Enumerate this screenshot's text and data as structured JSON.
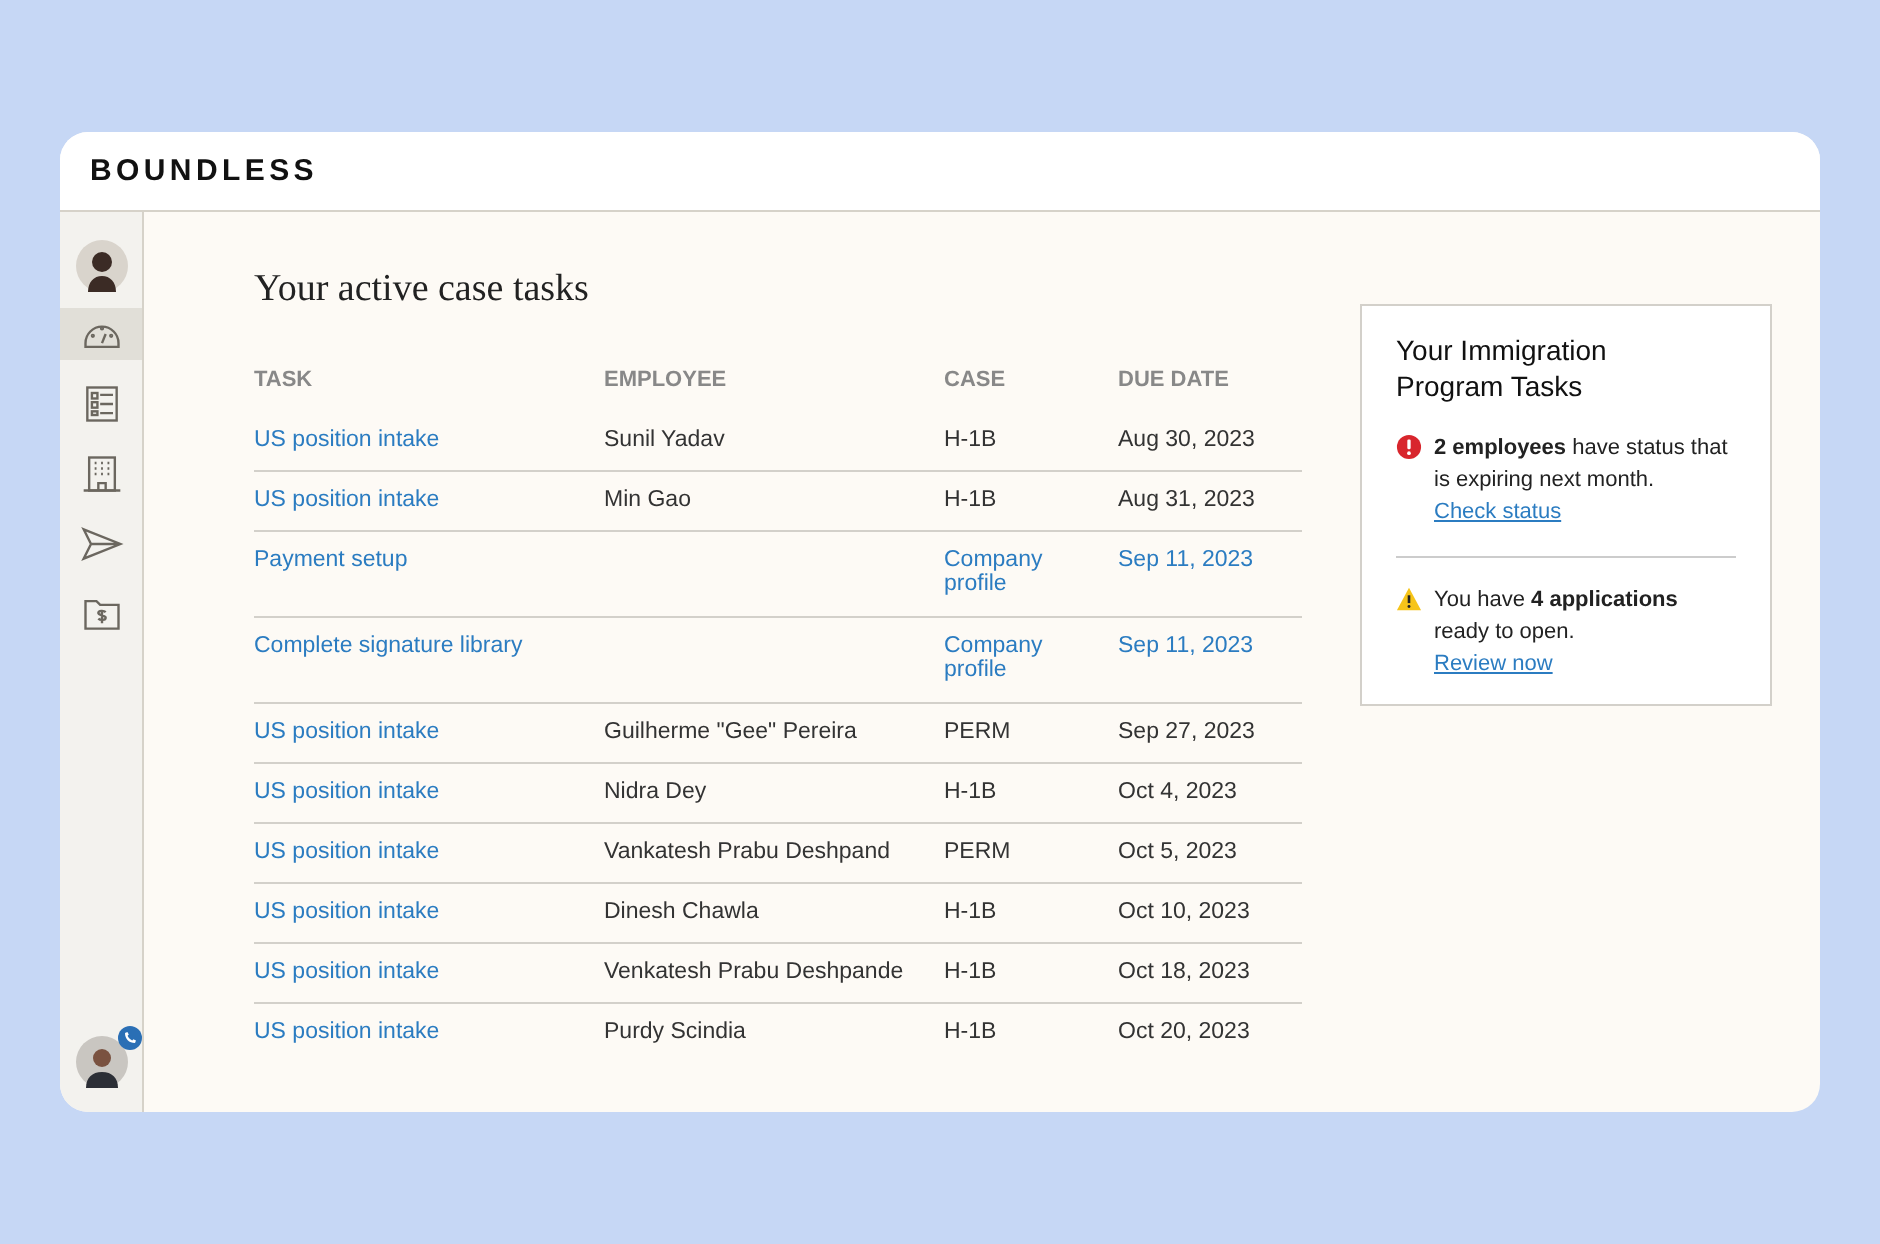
{
  "app": {
    "logo": "BOUNDLESS"
  },
  "sidebar": {
    "items": [
      {
        "kind": "gauge",
        "selected": true
      },
      {
        "kind": "list",
        "selected": false
      },
      {
        "kind": "building",
        "selected": false
      },
      {
        "kind": "send",
        "selected": false
      },
      {
        "kind": "folder",
        "selected": false
      }
    ]
  },
  "main": {
    "title": "Your active case tasks",
    "table": {
      "columns": [
        "TASK",
        "EMPLOYEE",
        "CASE",
        "DUE DATE"
      ],
      "rows": [
        {
          "kind": "employee",
          "task": "US position intake",
          "employee": "Sunil Yadav",
          "case": "H-1B",
          "due": "Aug 30, 2023"
        },
        {
          "kind": "employee",
          "task": "US position intake",
          "employee": "Min Gao",
          "case": "H-1B",
          "due": "Aug 31, 2023"
        },
        {
          "kind": "company",
          "task": "Payment setup",
          "case": "Company profile",
          "due": "Sep 11, 2023"
        },
        {
          "kind": "company",
          "task": "Complete signature library",
          "case": "Company profile",
          "due": "Sep 11, 2023"
        },
        {
          "kind": "employee",
          "task": "US position intake",
          "employee": "Guilherme \"Gee\" Pereira",
          "case": "PERM",
          "due": "Sep 27, 2023"
        },
        {
          "kind": "employee",
          "task": "US position intake",
          "employee": "Nidra Dey",
          "case": "H-1B",
          "due": "Oct 4, 2023"
        },
        {
          "kind": "employee",
          "task": "US position intake",
          "employee": "Vankatesh Prabu Deshpand",
          "case": "PERM",
          "due": "Oct 5, 2023"
        },
        {
          "kind": "employee",
          "task": "US position intake",
          "employee": "Dinesh Chawla",
          "case": "H-1B",
          "due": "Oct 10, 2023"
        },
        {
          "kind": "employee",
          "task": "US position intake",
          "employee": "Venkatesh Prabu Deshpande",
          "case": "H-1B",
          "due": "Oct 18, 2023"
        },
        {
          "kind": "employee",
          "task": "US position intake",
          "employee": "Purdy Scindia",
          "case": "H-1B",
          "due": "Oct 20, 2023"
        }
      ]
    }
  },
  "program_tasks": {
    "title": "Your Immigration Program Tasks",
    "alerts": [
      {
        "kind": "error",
        "text": "**2 employees** have status that is expiring next month.",
        "link": "Check status"
      },
      {
        "kind": "warning",
        "text": "You have **4 applications** ready to open.",
        "link": "Review now"
      }
    ]
  }
}
